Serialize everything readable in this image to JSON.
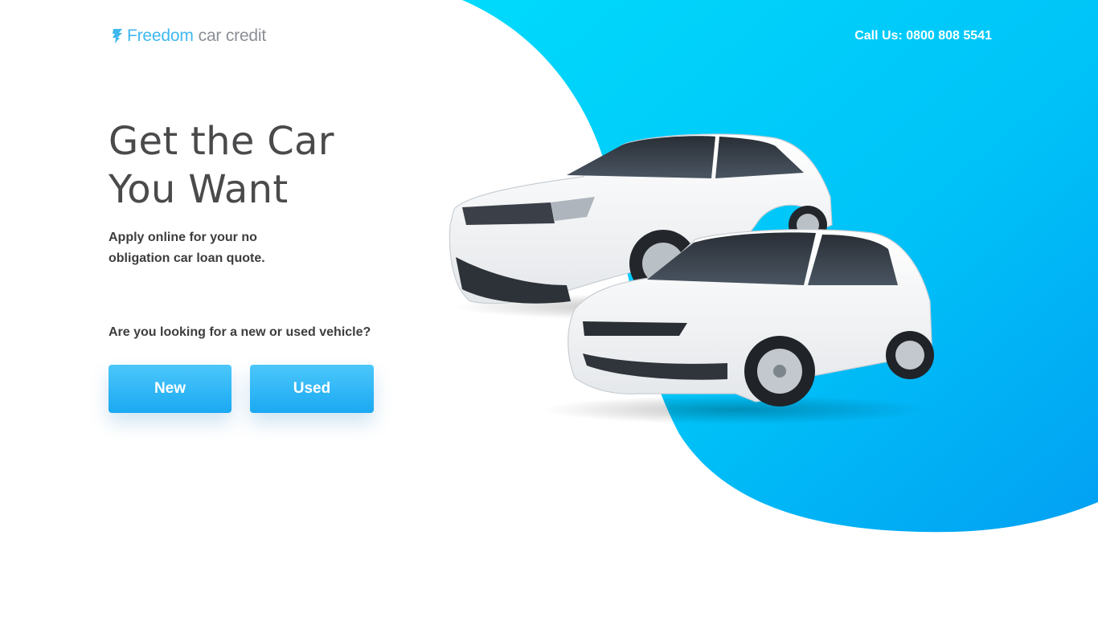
{
  "brand": {
    "name_primary": "Freedom",
    "name_secondary": "car credit",
    "color_primary": "#3fb8ee",
    "color_secondary": "#8a8f96"
  },
  "header": {
    "call_text": "Call Us: 0800 808 5541"
  },
  "hero": {
    "headline_line1": "Get the Car",
    "headline_line2": "You Want",
    "subtext": "Apply online for your no obligation car loan quote.",
    "question": "Are you looking for a new or used vehicle?"
  },
  "buttons": {
    "new_label": "New",
    "used_label": "Used"
  },
  "colors": {
    "accent": "#1aa9f2",
    "background_blob_start": "#00d7fb",
    "background_blob_end": "#02a3f2",
    "text": "#4a4a4c"
  },
  "icons": {
    "logo": "feather-logo-icon"
  },
  "images": {
    "cars": "two-white-cars-image"
  }
}
